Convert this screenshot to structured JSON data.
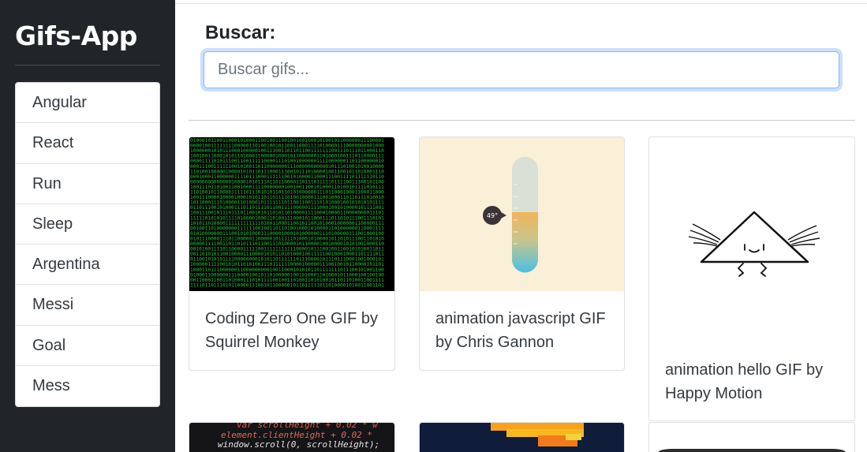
{
  "app": {
    "title": "Gifs-App"
  },
  "sidebar": {
    "history": [
      "Angular",
      "React",
      "Run",
      "Sleep",
      "Argentina",
      "Messi",
      "Goal",
      "Mess"
    ]
  },
  "search": {
    "label": "Buscar:",
    "placeholder": "Buscar gifs...",
    "value": ""
  },
  "gifs": [
    {
      "title": "Coding Zero One GIF by Squirrel Monkey"
    },
    {
      "title": "animation javascript GIF by Chris Gannon",
      "thermometer_reading": "49°"
    },
    {
      "title": "animation hello GIF by Happy Motion"
    }
  ],
  "partial_gifs": [
    {
      "code_lines": [
        "var scrollHeight + 0.02 * w",
        "element.clientHeight + 0.02 *",
        "window.scroll(0, scrollHeight);"
      ]
    }
  ],
  "colors": {
    "sidebar_bg": "#212529",
    "focus_ring": "#86b7fe",
    "matrix_green": "#22c93a"
  }
}
